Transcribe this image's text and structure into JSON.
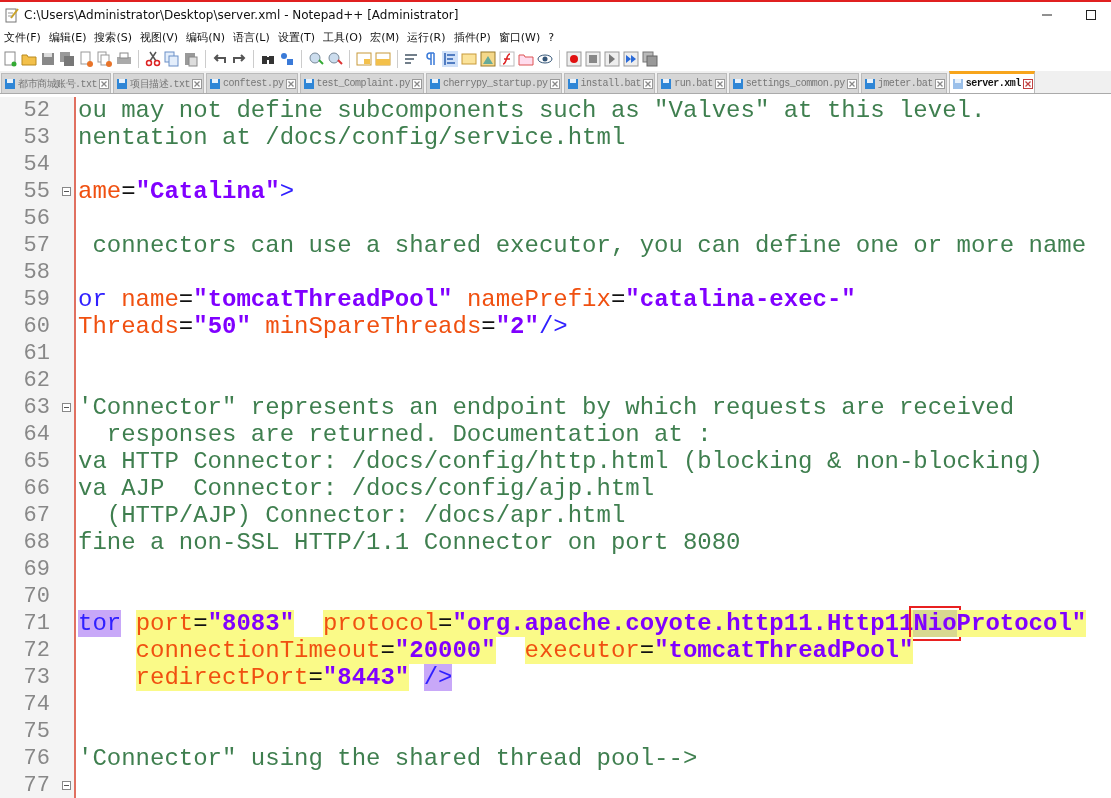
{
  "window": {
    "title": "C:\\Users\\Administrator\\Desktop\\server.xml - Notepad++ [Administrator]"
  },
  "menu": [
    "文件(F)",
    "编辑(E)",
    "搜索(S)",
    "视图(V)",
    "编码(N)",
    "语言(L)",
    "设置(T)",
    "工具(O)",
    "宏(M)",
    "运行(R)",
    "插件(P)",
    "窗口(W)",
    "?"
  ],
  "tabs": [
    {
      "label": "都市商城账号.txt",
      "selected": false
    },
    {
      "label": "项目描述.txt",
      "selected": false
    },
    {
      "label": "conftest.py",
      "selected": false
    },
    {
      "label": "test_Complaint.py",
      "selected": false
    },
    {
      "label": "cherrypy_startup.py",
      "selected": false
    },
    {
      "label": "install.bat",
      "selected": false
    },
    {
      "label": "run.bat",
      "selected": false
    },
    {
      "label": "settings_common.py",
      "selected": false
    },
    {
      "label": "jmeter.bat",
      "selected": false
    },
    {
      "label": "server.xml",
      "selected": true
    }
  ],
  "lines": [
    {
      "number": "52",
      "fold": false,
      "tokens": [
        {
          "text": "ou may not define subcomponents such as \"Valves\" at this level.",
          "kind": "comment"
        }
      ]
    },
    {
      "number": "53",
      "fold": false,
      "tokens": [
        {
          "text": "nentation at /docs/config/service.html",
          "kind": "comment"
        }
      ]
    },
    {
      "number": "54",
      "fold": false
    },
    {
      "number": "55",
      "fold": true,
      "tokens": [
        {
          "text": "ame",
          "kind": "attr"
        },
        {
          "text": "=",
          "kind": "plain"
        },
        {
          "text": "\"Catalina\"",
          "kind": "value"
        },
        {
          "text": ">",
          "kind": "tag"
        }
      ]
    },
    {
      "number": "56",
      "fold": false
    },
    {
      "number": "57",
      "fold": false,
      "tokens": [
        {
          "text": " connectors can use a shared executor, you can define one or more name",
          "kind": "comment"
        }
      ]
    },
    {
      "number": "58",
      "fold": false
    },
    {
      "number": "59",
      "fold": false,
      "tokens": [
        {
          "text": "or",
          "kind": "tag"
        },
        {
          "text": " name",
          "kind": "attr"
        },
        {
          "text": "=",
          "kind": "plain"
        },
        {
          "text": "\"tomcatThreadPool\"",
          "kind": "value"
        },
        {
          "text": " namePrefix",
          "kind": "attr"
        },
        {
          "text": "=",
          "kind": "plain"
        },
        {
          "text": "\"catalina-exec-\"",
          "kind": "value"
        }
      ]
    },
    {
      "number": "60",
      "fold": false,
      "tokens": [
        {
          "text": "Threads",
          "kind": "attr"
        },
        {
          "text": "=",
          "kind": "plain"
        },
        {
          "text": "\"50\"",
          "kind": "value"
        },
        {
          "text": " minSpareThreads",
          "kind": "attr"
        },
        {
          "text": "=",
          "kind": "plain"
        },
        {
          "text": "\"2\"",
          "kind": "value"
        },
        {
          "text": "/>",
          "kind": "tag"
        }
      ]
    },
    {
      "number": "61",
      "fold": false
    },
    {
      "number": "62",
      "fold": false
    },
    {
      "number": "63",
      "fold": true,
      "tokens": [
        {
          "text": "'Connector\" represents an endpoint by which requests are received",
          "kind": "comment"
        }
      ]
    },
    {
      "number": "64",
      "fold": false,
      "tokens": [
        {
          "text": "  responses are returned. Documentation at :",
          "kind": "comment"
        }
      ]
    },
    {
      "number": "65",
      "fold": false,
      "tokens": [
        {
          "text": "va HTTP Connector: /docs/config/http.html (blocking & non-blocking)",
          "kind": "comment"
        }
      ]
    },
    {
      "number": "66",
      "fold": false,
      "tokens": [
        {
          "text": "va AJP  Connector: /docs/config/ajp.html",
          "kind": "comment"
        }
      ]
    },
    {
      "number": "67",
      "fold": false,
      "tokens": [
        {
          "text": "  (HTTP/AJP) Connector: /docs/apr.html",
          "kind": "comment"
        }
      ]
    },
    {
      "number": "68",
      "fold": false,
      "tokens": [
        {
          "text": "fine a non-SSL HTTP/1.1 Connector on port 8080",
          "kind": "comment"
        }
      ]
    },
    {
      "number": "69",
      "fold": false
    },
    {
      "number": "70",
      "fold": false
    },
    {
      "number": "71",
      "fold": false,
      "tokens": [
        {
          "text": "tor",
          "kind": "tag",
          "matched": true,
          "highlighted": false,
          "selected": false,
          "boxed": false
        },
        {
          "text": " port",
          "kind": "attr",
          "matched": false,
          "highlighted": true,
          "selected": false,
          "boxed": false
        },
        {
          "text": "=",
          "kind": "plain",
          "matched": false,
          "highlighted": true,
          "selected": false,
          "boxed": false
        },
        {
          "text": "\"8083\"",
          "kind": "value",
          "matched": false,
          "highlighted": true,
          "selected": false,
          "boxed": false
        },
        {
          "text": "  protocol",
          "kind": "attr",
          "matched": false,
          "highlighted": true,
          "selected": false,
          "boxed": false
        },
        {
          "text": "=",
          "kind": "plain",
          "matched": false,
          "highlighted": true,
          "selected": false,
          "boxed": false
        },
        {
          "text": "\"org.apache.coyote.http11.Http11",
          "kind": "value",
          "matched": false,
          "highlighted": true,
          "selected": false,
          "boxed": false
        },
        {
          "text": "Nio",
          "kind": "value",
          "matched": false,
          "highlighted": false,
          "selected": true,
          "boxed": true
        },
        {
          "text": "Protocol\"",
          "kind": "value",
          "matched": false,
          "highlighted": true,
          "selected": false,
          "boxed": false
        }
      ]
    },
    {
      "number": "72",
      "fold": false,
      "tokens": [
        {
          "text": "    connectionTimeout",
          "kind": "attr",
          "matched": false,
          "highlighted": true,
          "selected": false,
          "boxed": false
        },
        {
          "text": "=",
          "kind": "plain",
          "matched": false,
          "highlighted": true,
          "selected": false,
          "boxed": false
        },
        {
          "text": "\"20000\"",
          "kind": "value",
          "matched": false,
          "highlighted": true,
          "selected": false,
          "boxed": false
        },
        {
          "text": "  executor",
          "kind": "attr",
          "matched": false,
          "highlighted": true,
          "selected": false,
          "boxed": false
        },
        {
          "text": "=",
          "kind": "plain",
          "matched": false,
          "highlighted": true,
          "selected": false,
          "boxed": false
        },
        {
          "text": "\"tomcatThreadPool\"",
          "kind": "value",
          "matched": false,
          "highlighted": true,
          "selected": false,
          "boxed": false
        }
      ]
    },
    {
      "number": "73",
      "fold": false,
      "tokens": [
        {
          "text": "    redirectPort",
          "kind": "attr",
          "matched": false,
          "highlighted": true,
          "selected": false,
          "boxed": false
        },
        {
          "text": "=",
          "kind": "plain",
          "matched": false,
          "highlighted": true,
          "selected": false,
          "boxed": false
        },
        {
          "text": "\"8443\"",
          "kind": "value",
          "matched": false,
          "highlighted": true,
          "selected": false,
          "boxed": false
        },
        {
          "text": " />",
          "kind": "tag",
          "matched": true,
          "highlighted": false,
          "selected": false,
          "boxed": false
        }
      ]
    },
    {
      "number": "74",
      "fold": false
    },
    {
      "number": "75",
      "fold": false
    },
    {
      "number": "76",
      "fold": false,
      "tokens": [
        {
          "text": "'Connector\" using the shared thread pool-->",
          "kind": "comment"
        }
      ]
    },
    {
      "number": "77",
      "fold": true
    }
  ]
}
